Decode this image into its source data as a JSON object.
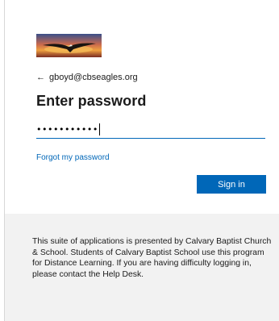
{
  "login": {
    "identity_email": "gboyd@cbseagles.org",
    "title": "Enter password",
    "password_masked": "•••••••••••",
    "forgot_link": "Forgot my password",
    "signin_label": "Sign in"
  },
  "icons": {
    "back": "left-arrow"
  },
  "footer": {
    "message": "This suite of applications is presented by Calvary Baptist Church & School. Students of Calvary Baptist School use this program for Distance Learning. If you are having difficulty logging in, please contact the Help Desk."
  },
  "colors": {
    "accent": "#0067b8",
    "footer_bg": "#f2f2f2"
  }
}
